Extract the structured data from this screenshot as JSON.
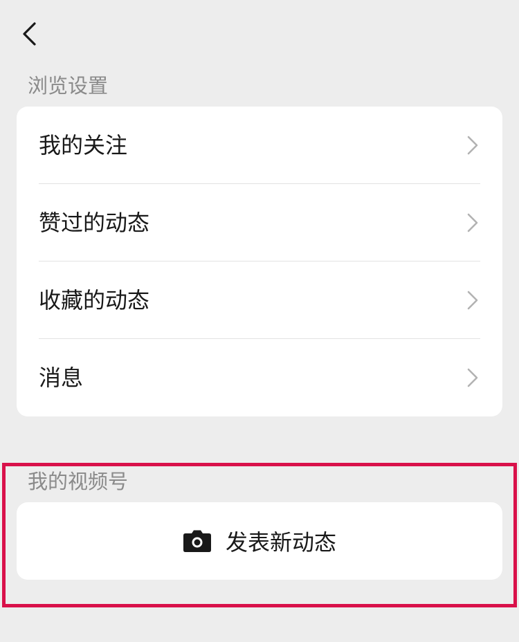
{
  "nav": {
    "back_icon": "chevron-left-icon"
  },
  "browse_settings": {
    "title": "浏览设置",
    "items": [
      {
        "label": "我的关注",
        "icon": "chevron-right-icon"
      },
      {
        "label": "赞过的动态",
        "icon": "chevron-right-icon"
      },
      {
        "label": "收藏的动态",
        "icon": "chevron-right-icon"
      },
      {
        "label": "消息",
        "icon": "chevron-right-icon"
      }
    ]
  },
  "my_channel": {
    "title": "我的视频号",
    "publish_label": "发表新动态",
    "publish_icon": "camera-icon"
  },
  "colors": {
    "background": "#ededed",
    "card": "#ffffff",
    "highlight_border": "#d9114a",
    "section_title": "#8a8a8a",
    "text": "#191919"
  }
}
